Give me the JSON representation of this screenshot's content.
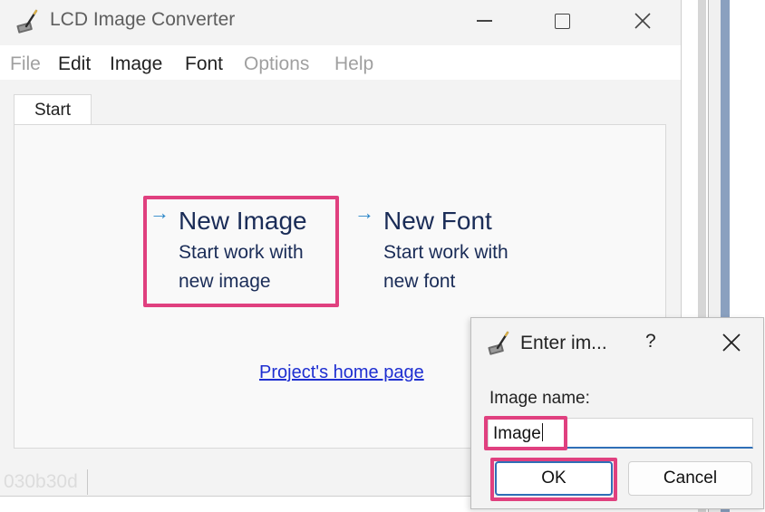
{
  "window": {
    "title": "LCD Image Converter",
    "minimize_glyph": "—",
    "close_glyph": "✕"
  },
  "menu": {
    "items": [
      {
        "label": "File",
        "enabled": false
      },
      {
        "label": "Edit",
        "enabled": true
      },
      {
        "label": "Image",
        "enabled": true
      },
      {
        "label": "Font",
        "enabled": true
      },
      {
        "label": "Options",
        "enabled": false
      },
      {
        "label": "Help",
        "enabled": false
      }
    ]
  },
  "tabs": [
    {
      "label": "Start",
      "active": true
    }
  ],
  "start": {
    "new_image": {
      "arrow": "→",
      "title": "New Image",
      "desc_line1": "Start work with",
      "desc_line2": "new image"
    },
    "new_font": {
      "arrow": "→",
      "title": "New Font",
      "desc_line1": "Start work with",
      "desc_line2": "new font"
    },
    "home_link": "Project's home page"
  },
  "status": {
    "text": "030b30d"
  },
  "dialog": {
    "title": "Enter im...",
    "help": "?",
    "field_label": "Image name:",
    "field_value": "Image",
    "ok_label": "OK",
    "cancel_label": "Cancel"
  },
  "colors": {
    "highlight": "#e0407f",
    "accent": "#2f6fb7",
    "link": "#1e2fd1",
    "action_text": "#1a2c57",
    "disabled_text": "#a0a0a0"
  },
  "icons": [
    "app-icon",
    "minimize-icon",
    "maximize-icon",
    "close-icon",
    "arrow-right-icon",
    "dialog-app-icon",
    "dialog-close-icon"
  ]
}
